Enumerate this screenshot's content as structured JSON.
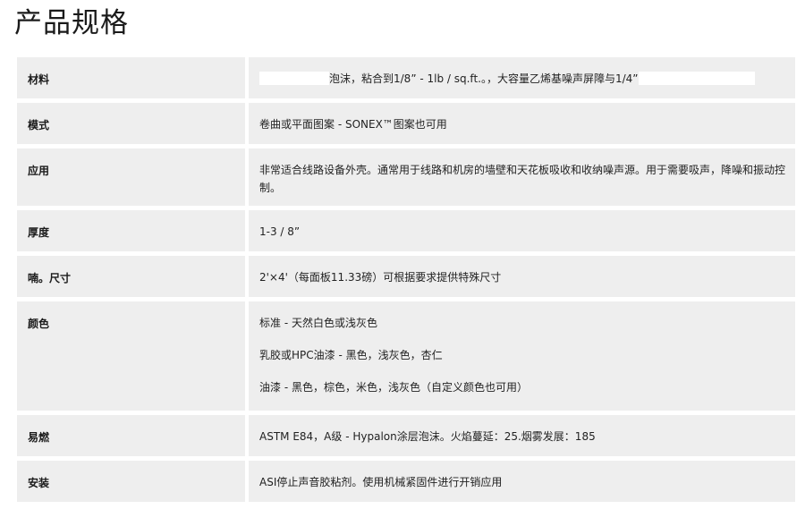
{
  "page": {
    "title": "产品规格"
  },
  "specs": [
    {
      "label": "材料",
      "value_main": "泡沫，粘合到1/8” - 1lb / sq.ft.。，大容量乙烯基噪声屏障与1/4”"
    },
    {
      "label": "模式",
      "value": "卷曲或平面图案 - SONEX™图案也可用"
    },
    {
      "label": "应用",
      "value": "非常适合线路设备外壳。通常用于线路和机房的墙壁和天花板吸收和收纳噪声源。用于需要吸声，降噪和振动控制。"
    },
    {
      "label": "厚度",
      "value": "1-3 / 8”"
    },
    {
      "label": "喃。尺寸",
      "value": "2'×4'（每面板11.33磅）可根据要求提供特殊尺寸"
    },
    {
      "label": "颜色",
      "values": [
        "标准 - 天然白色或浅灰色",
        "乳胶或HPC油漆 - 黑色，浅灰色，杏仁",
        "油漆 - 黑色，棕色，米色，浅灰色（自定义颜色也可用）"
      ]
    },
    {
      "label": "易燃",
      "value": "ASTM E84，A级 - Hypalon涂层泡沫。火焰蔓延：25.烟雾发展：185"
    },
    {
      "label": "安装",
      "value": "ASI停止声音胶粘剂。使用机械紧固件进行开销应用"
    }
  ]
}
